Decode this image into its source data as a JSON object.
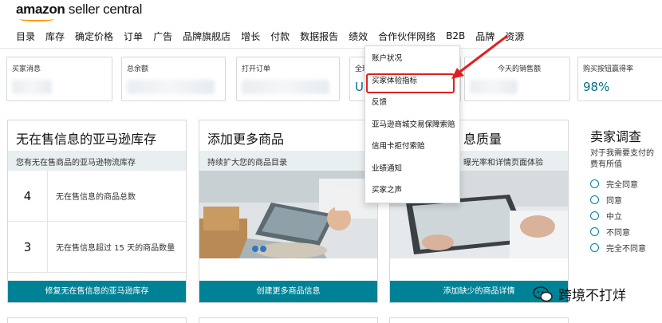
{
  "app": {
    "brand": "amazon",
    "title_rest": " seller central"
  },
  "nav": [
    "目录",
    "库存",
    "确定价格",
    "订单",
    "广告",
    "品牌旗舰店",
    "增长",
    "付款",
    "数据报告",
    "绩效",
    "合作伙伴网络",
    "B2B",
    "品牌",
    "资源"
  ],
  "metrics": [
    {
      "label": "买家消息",
      "value": ""
    },
    {
      "label": "总余额",
      "value": ""
    },
    {
      "label": "打开订单",
      "value": ""
    },
    {
      "label": "全球",
      "value": "U"
    },
    {
      "label": "今天的销售额",
      "value": ""
    },
    {
      "label": "购买按钮赢得率",
      "value": "98%"
    }
  ],
  "widgets": {
    "inventory": {
      "title": "无在售信息的亚马逊库存",
      "subtitle": "您有无在售商品的亚马逊物流库存",
      "rows": [
        {
          "num": "4",
          "text": "无在售信息的商品总数"
        },
        {
          "num": "3",
          "text": "无在售信息超过 15 天的商品数量"
        }
      ],
      "button": "修复无在售信息的亚马逊库存"
    },
    "add_products": {
      "title": "添加更多商品",
      "subtitle": "持续扩大您的商品目录",
      "button": "创建更多商品信息"
    },
    "quality": {
      "title": "息质量",
      "subtitle": "曝光率和详情页面体验",
      "button": "添加缺少的商品详情"
    },
    "survey": {
      "title": "卖家调查",
      "question": "对于我需要支付的费有所值",
      "options": [
        "完全同意",
        "同意",
        "中立",
        "不同意",
        "完全不同意"
      ]
    }
  },
  "dropdown": {
    "items": [
      "账户状况",
      "买家体验指标",
      "反馈",
      "亚马逊商城交易保障索赔",
      "信用卡拒付索赔",
      "业绩通知",
      "买家之声"
    ],
    "highlighted_index": 1
  },
  "watermark": "跨境不打烊",
  "colors": {
    "accent": "#008296",
    "highlight": "#e02020",
    "link": "#007185",
    "brand": "#ff9900"
  }
}
